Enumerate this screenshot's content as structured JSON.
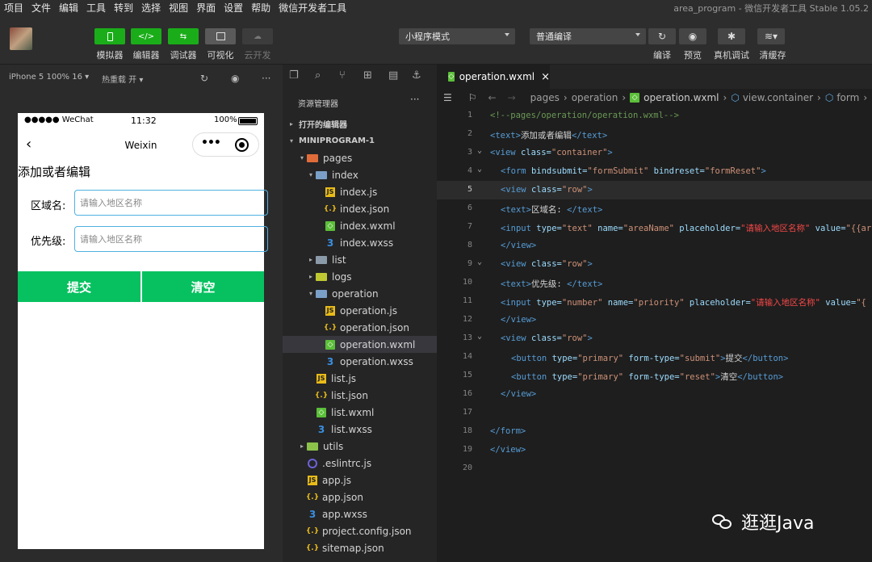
{
  "menubar": {
    "items": [
      "项目",
      "文件",
      "编辑",
      "工具",
      "转到",
      "选择",
      "视图",
      "界面",
      "设置",
      "帮助",
      "微信开发者工具"
    ],
    "window_title": "area_program - 微信开发者工具 Stable 1.05.2"
  },
  "toolbar": {
    "simulator": "模拟器",
    "editor": "编辑器",
    "debugger": "调试器",
    "visual": "可视化",
    "cloud": "云开发",
    "mode_select": "小程序模式",
    "compile_select": "普通编译",
    "compile": "编译",
    "preview": "预览",
    "remote_debug": "真机调试",
    "clear_cache": "清缓存",
    "icons": {
      "simulator": "</>",
      "editor": "</>",
      "debugger": "⇆"
    }
  },
  "simulator_bar": {
    "device": "iPhone 5 100% 16 ▾",
    "hot_reload": "热重载 开 ▾"
  },
  "phone": {
    "carrier": "●●●●● WeChat",
    "time": "11:32",
    "battery": "100%",
    "nav_title": "Weixin",
    "heading": "添加或者编辑",
    "area_label": "区域名:",
    "area_placeholder": "请输入地区名称",
    "priority_label": "优先级:",
    "priority_placeholder": "请输入地区名称",
    "submit": "提交",
    "reset": "清空"
  },
  "explorer": {
    "title": "资源管理器",
    "open_editors": "打开的编辑器",
    "project": "MINIPROGRAM-1",
    "tree": [
      {
        "depth": 1,
        "twisty": "▾",
        "icon": "folder-red",
        "label": "pages"
      },
      {
        "depth": 2,
        "twisty": "▾",
        "icon": "folder-open",
        "label": "index"
      },
      {
        "depth": 3,
        "twisty": "",
        "icon": "js",
        "label": "index.js"
      },
      {
        "depth": 3,
        "twisty": "",
        "icon": "json",
        "label": "index.json"
      },
      {
        "depth": 3,
        "twisty": "",
        "icon": "wxml",
        "label": "index.wxml"
      },
      {
        "depth": 3,
        "twisty": "",
        "icon": "wxss",
        "label": "index.wxss"
      },
      {
        "depth": 2,
        "twisty": "▸",
        "icon": "folder",
        "label": "list"
      },
      {
        "depth": 2,
        "twisty": "▸",
        "icon": "folder-logs",
        "label": "logs"
      },
      {
        "depth": 2,
        "twisty": "▾",
        "icon": "folder-open",
        "label": "operation"
      },
      {
        "depth": 3,
        "twisty": "",
        "icon": "js",
        "label": "operation.js"
      },
      {
        "depth": 3,
        "twisty": "",
        "icon": "json",
        "label": "operation.json"
      },
      {
        "depth": 3,
        "twisty": "",
        "icon": "wxml",
        "label": "operation.wxml",
        "selected": true
      },
      {
        "depth": 3,
        "twisty": "",
        "icon": "wxss",
        "label": "operation.wxss"
      },
      {
        "depth": 2,
        "twisty": "",
        "icon": "js",
        "label": "list.js"
      },
      {
        "depth": 2,
        "twisty": "",
        "icon": "json",
        "label": "list.json"
      },
      {
        "depth": 2,
        "twisty": "",
        "icon": "wxml",
        "label": "list.wxml"
      },
      {
        "depth": 2,
        "twisty": "",
        "icon": "wxss",
        "label": "list.wxss"
      },
      {
        "depth": 1,
        "twisty": "▸",
        "icon": "folder-utils",
        "label": "utils"
      },
      {
        "depth": 1,
        "twisty": "",
        "icon": "eslint",
        "label": ".eslintrc.js"
      },
      {
        "depth": 1,
        "twisty": "",
        "icon": "js",
        "label": "app.js"
      },
      {
        "depth": 1,
        "twisty": "",
        "icon": "json",
        "label": "app.json"
      },
      {
        "depth": 1,
        "twisty": "",
        "icon": "wxss",
        "label": "app.wxss"
      },
      {
        "depth": 1,
        "twisty": "",
        "icon": "json",
        "label": "project.config.json"
      },
      {
        "depth": 1,
        "twisty": "",
        "icon": "json",
        "label": "sitemap.json"
      }
    ]
  },
  "editor": {
    "tab": "operation.wxml",
    "breadcrumbs": [
      "pages",
      "operation",
      "operation.wxml",
      "view.container",
      "form"
    ],
    "current_line": 5,
    "lines": [
      {
        "n": 1,
        "fold": "",
        "indent": 0,
        "tokens": [
          [
            "c",
            "<!--pages/operation/operation.wxml-->"
          ]
        ]
      },
      {
        "n": 2,
        "fold": "",
        "indent": 0,
        "tokens": [
          [
            "t",
            "<text>"
          ],
          [
            "x",
            "添加或者编辑"
          ],
          [
            "t",
            "</text>"
          ]
        ]
      },
      {
        "n": 3,
        "fold": "v",
        "indent": 0,
        "tokens": [
          [
            "t",
            "<view "
          ],
          [
            "a",
            "class="
          ],
          [
            "s",
            "\"container\""
          ],
          [
            "t",
            ">"
          ]
        ]
      },
      {
        "n": 4,
        "fold": "v",
        "indent": 1,
        "tokens": [
          [
            "t",
            "<form "
          ],
          [
            "a",
            "bindsubmit="
          ],
          [
            "s",
            "\"formSubmit\""
          ],
          [
            "a",
            " bindreset="
          ],
          [
            "s",
            "\"formReset\""
          ],
          [
            "t",
            ">"
          ]
        ]
      },
      {
        "n": 5,
        "fold": "",
        "indent": 1,
        "tokens": [
          [
            "t",
            "<view "
          ],
          [
            "a",
            "class="
          ],
          [
            "s",
            "\"row\""
          ],
          [
            "t",
            ">"
          ]
        ]
      },
      {
        "n": 6,
        "fold": "",
        "indent": 1,
        "tokens": [
          [
            "t",
            "<text>"
          ],
          [
            "x",
            "区域名: "
          ],
          [
            "t",
            "</text>"
          ]
        ]
      },
      {
        "n": 7,
        "fold": "",
        "indent": 1,
        "tokens": [
          [
            "t",
            "<input "
          ],
          [
            "a",
            "type="
          ],
          [
            "s",
            "\"text\""
          ],
          [
            "a",
            " name="
          ],
          [
            "s",
            "\"areaName\""
          ],
          [
            "a",
            " placeholder="
          ],
          [
            "r",
            "\"请输入地区名称\""
          ],
          [
            "a",
            " value="
          ],
          [
            "s",
            "\"{{ar"
          ]
        ]
      },
      {
        "n": 8,
        "fold": "",
        "indent": 1,
        "tokens": [
          [
            "t",
            "</view>"
          ]
        ]
      },
      {
        "n": 9,
        "fold": "v",
        "indent": 1,
        "tokens": [
          [
            "t",
            "<view "
          ],
          [
            "a",
            "class="
          ],
          [
            "s",
            "\"row\""
          ],
          [
            "t",
            ">"
          ]
        ]
      },
      {
        "n": 10,
        "fold": "",
        "indent": 1,
        "tokens": [
          [
            "t",
            "<text>"
          ],
          [
            "x",
            "优先级: "
          ],
          [
            "t",
            "</text>"
          ]
        ]
      },
      {
        "n": 11,
        "fold": "",
        "indent": 1,
        "tokens": [
          [
            "t",
            "<input "
          ],
          [
            "a",
            "type="
          ],
          [
            "s",
            "\"number\""
          ],
          [
            "a",
            " name="
          ],
          [
            "s",
            "\"priority\""
          ],
          [
            "a",
            " placeholder="
          ],
          [
            "r",
            "\"请输入地区名称\""
          ],
          [
            "a",
            " value="
          ],
          [
            "s",
            "\"{"
          ]
        ]
      },
      {
        "n": 12,
        "fold": "",
        "indent": 1,
        "tokens": [
          [
            "t",
            "</view>"
          ]
        ]
      },
      {
        "n": 13,
        "fold": "v",
        "indent": 1,
        "tokens": [
          [
            "t",
            "<view "
          ],
          [
            "a",
            "class="
          ],
          [
            "s",
            "\"row\""
          ],
          [
            "t",
            ">"
          ]
        ]
      },
      {
        "n": 14,
        "fold": "",
        "indent": 2,
        "tokens": [
          [
            "t",
            "<button "
          ],
          [
            "a",
            "type="
          ],
          [
            "s",
            "\"primary\""
          ],
          [
            "a",
            " form-type="
          ],
          [
            "s",
            "\"submit\""
          ],
          [
            "t",
            ">"
          ],
          [
            "x",
            "提交"
          ],
          [
            "t",
            "</button>"
          ]
        ]
      },
      {
        "n": 15,
        "fold": "",
        "indent": 2,
        "tokens": [
          [
            "t",
            "<button "
          ],
          [
            "a",
            "type="
          ],
          [
            "s",
            "\"primary\""
          ],
          [
            "a",
            " form-type="
          ],
          [
            "s",
            "\"reset\""
          ],
          [
            "t",
            ">"
          ],
          [
            "x",
            "清空"
          ],
          [
            "t",
            "</button>"
          ]
        ]
      },
      {
        "n": 16,
        "fold": "",
        "indent": 1,
        "tokens": [
          [
            "t",
            "</view>"
          ]
        ]
      },
      {
        "n": 17,
        "fold": "",
        "indent": 0,
        "tokens": []
      },
      {
        "n": 18,
        "fold": "",
        "indent": 0,
        "tokens": [
          [
            "t",
            "</form>"
          ]
        ]
      },
      {
        "n": 19,
        "fold": "",
        "indent": 0,
        "tokens": [
          [
            "t",
            "</view>"
          ]
        ]
      },
      {
        "n": 20,
        "fold": "",
        "indent": 0,
        "tokens": []
      }
    ]
  },
  "watermark": "逛逛Java"
}
